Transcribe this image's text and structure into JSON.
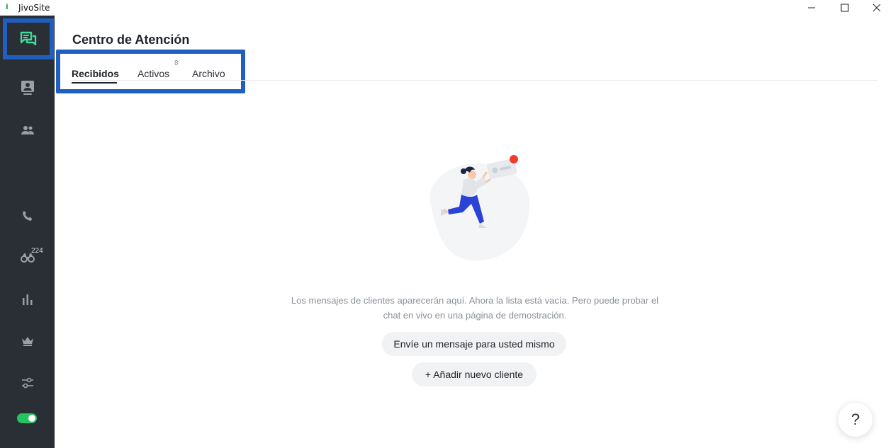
{
  "window": {
    "title": "JivoSite",
    "app_icon": "jivosite-logo-icon",
    "controls": [
      "minimize-icon",
      "maximize-icon",
      "close-icon"
    ]
  },
  "sidebar": {
    "items": [
      {
        "icon": "chat-bubbles-icon",
        "active": true
      },
      {
        "icon": "contact-card-icon"
      },
      {
        "icon": "team-icon"
      },
      {
        "icon": "phone-icon"
      },
      {
        "icon": "binoculars-icon",
        "badge": "224"
      },
      {
        "icon": "bar-chart-icon"
      },
      {
        "icon": "crown-icon"
      },
      {
        "icon": "settings-sliders-icon"
      }
    ],
    "status_toggle_on": true,
    "accent": "#3ddc97",
    "bg": "#2a2e35"
  },
  "header": {
    "title": "Centro de Atención"
  },
  "tabs": [
    {
      "label": "Recibidos",
      "active": true
    },
    {
      "label": "Activos",
      "badge": "8"
    },
    {
      "label": "Archivo"
    }
  ],
  "empty_state": {
    "illustration": "person-running-with-chat-card-illustration",
    "message_line1": "Los mensajes de clientes aparecerán aquí. Ahora la lista está vacía. Pero puede probar el",
    "message_line2": "chat en vivo en una página de demostración.",
    "send_button": "Envíe un mensaje para usted mismo",
    "add_button": "+ Añadir nuevo cliente"
  },
  "help": {
    "label": "?"
  },
  "colors": {
    "highlight_box": "#1f5fbf",
    "toggle_on": "#22c55e"
  }
}
